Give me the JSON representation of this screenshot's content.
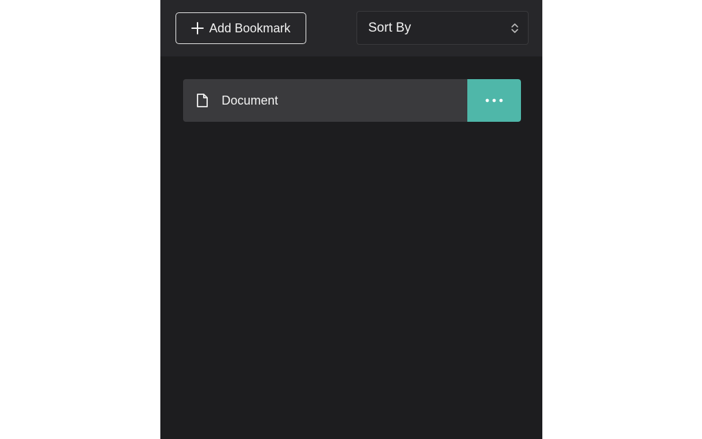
{
  "toolbar": {
    "add_bookmark_label": "Add Bookmark",
    "sort_label": "Sort By",
    "add_icon": "plus-icon",
    "sort_icon": "chevron-up-down-icon"
  },
  "bookmarks": [
    {
      "label": "Document",
      "icon": "document-icon",
      "action_icon": "more-horizontal-icon"
    }
  ],
  "colors": {
    "panel_bg": "#1d1d1f",
    "toolbar_bg": "#27272a",
    "item_bg": "#3a3a3d",
    "accent": "#4fb7a9",
    "text": "#f2f2f2"
  }
}
